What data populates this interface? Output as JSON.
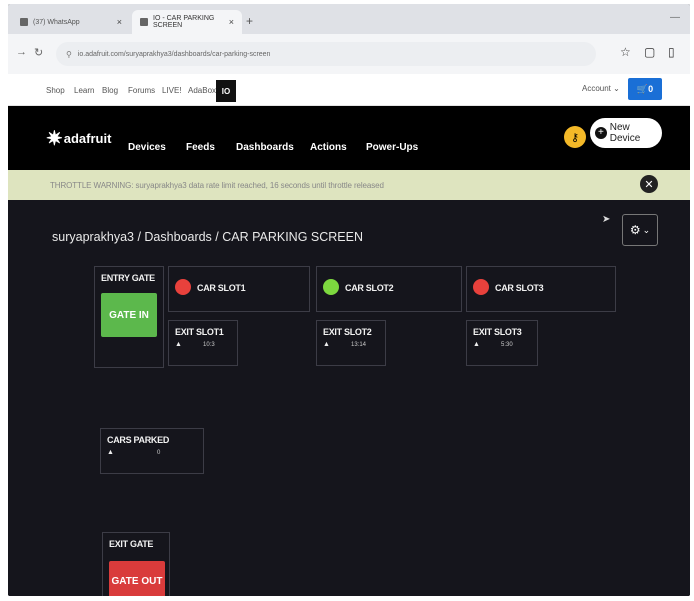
{
  "browser": {
    "tabs": [
      {
        "label": "(37) WhatsApp"
      },
      {
        "label": "IO - CAR PARKING SCREEN"
      }
    ],
    "url": "io.adafruit.com/suryaprakhya3/dashboards/car-parking-screen"
  },
  "topbar": {
    "links": [
      "Shop",
      "Learn",
      "Blog",
      "Forums",
      "LIVE!",
      "AdaBox"
    ],
    "io_label": "IO",
    "account_label": "Account",
    "cart_count": "0"
  },
  "nav": {
    "logo_text": "adafruit",
    "items": [
      "Devices",
      "Feeds",
      "Dashboards",
      "Actions",
      "Power-Ups"
    ],
    "new_device_label": "New Device"
  },
  "warning": {
    "text": "THROTTLE WARNING: suryaprakhya3 data rate limit reached, 16 seconds until throttle released"
  },
  "breadcrumb": "suryaprakhya3 / Dashboards / CAR PARKING SCREEN",
  "blocks": {
    "entry_gate": {
      "title": "ENTRY GATE",
      "button_label": "GATE IN"
    },
    "slots": [
      {
        "name": "CAR SLOT1",
        "led_color": "#e8413c"
      },
      {
        "name": "CAR SLOT2",
        "led_color": "#7dd83f"
      },
      {
        "name": "CAR SLOT3",
        "led_color": "#e8413c"
      }
    ],
    "exit_slots": [
      {
        "title": "EXIT SLOT1",
        "value": "10:3"
      },
      {
        "title": "EXIT SLOT2",
        "value": "13:14"
      },
      {
        "title": "EXIT SLOT3",
        "value": "5:30"
      }
    ],
    "cars_parked": {
      "title": "CARS PARKED",
      "value": "0"
    },
    "exit_gate": {
      "title": "EXIT GATE",
      "button_label": "GATE OUT"
    }
  },
  "colors": {
    "gate_in": "#5cb84c",
    "gate_out": "#d93b3b",
    "warning_bg": "#dee4bf",
    "cart": "#1a6fd6",
    "key": "#f4b928"
  },
  "icons": {
    "car": "car-icon",
    "gear": "gear-icon",
    "key": "key-icon",
    "close": "close-icon",
    "cart": "cart-icon"
  }
}
